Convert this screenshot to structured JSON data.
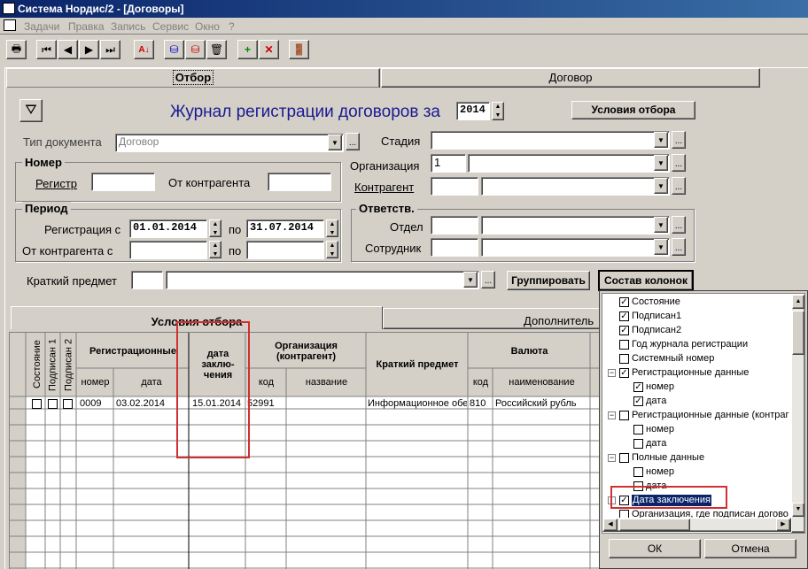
{
  "window": {
    "title": "Система Нордис/2 - [Договоры]"
  },
  "menu": [
    "Задачи",
    "Правка",
    "Запись",
    "Сервис",
    "Окно",
    "?"
  ],
  "tabs": {
    "top_left": "Отбор",
    "top_right": "Договор",
    "bottom_left": "Условия отбора",
    "bottom_right": "Дополнитель"
  },
  "header": {
    "title": "Журнал регистрации договоров за",
    "year": "2014",
    "conditions_button": "Условия отбора"
  },
  "form": {
    "doc_type_label": "Тип документа",
    "doc_type_value": "Договор",
    "stage_label": "Стадия",
    "number_group": "Номер",
    "register_label": "Регистр",
    "from_contractor_label": "От контрагента",
    "org_label": "Организация",
    "org_code": "1",
    "contractor_label": "Контрагент",
    "period_group": "Период",
    "reg_from_label": "Регистрация с",
    "reg_from": "01.01.2014",
    "to_label": "по",
    "reg_to": "31.07.2014",
    "contractor_from_label": "От контрагента с",
    "to_label2": "по",
    "resp_group": "Ответств.",
    "dept_label": "Отдел",
    "employee_label": "Сотрудник",
    "subject_label": "Краткий предмет",
    "group_button": "Группировать",
    "columns_button": "Состав колонок"
  },
  "grid": {
    "vheaders": [
      "Состояние",
      "Подписан 1",
      "Подписан 2"
    ],
    "h_reg": "Регистрационные",
    "h_date": "дата заклю- чения",
    "h_org": "Организация (контрагент)",
    "h_subject": "Краткий предмет",
    "h_currency": "Валюта",
    "s_number": "номер",
    "s_date": "дата",
    "s_code": "код",
    "s_name": "название",
    "s_code2": "код",
    "s_curname": "наименование",
    "rows": [
      {
        "number": "0009",
        "date": "03.02.2014",
        "contract_date": "15.01.2014",
        "org_code": "52991",
        "org_name": "",
        "subject": "Информационное обе",
        "cur_code": "810",
        "cur_name": "Российский рубль"
      }
    ]
  },
  "columns_popup": {
    "items": [
      {
        "label": "Состояние",
        "checked": "✓"
      },
      {
        "label": "Подписан1",
        "checked": "✓"
      },
      {
        "label": "Подписан2",
        "checked": "✓"
      },
      {
        "label": "Год журнала регистрации",
        "checked": ""
      },
      {
        "label": "Системный номер",
        "checked": ""
      },
      {
        "label": "Регистрационные данные",
        "checked": "✓"
      },
      {
        "label": "номер",
        "checked": "✓"
      },
      {
        "label": "дата",
        "checked": "✓"
      },
      {
        "label": "Регистрационные данные (контраг",
        "checked": ""
      },
      {
        "label": "номер",
        "checked": ""
      },
      {
        "label": "дата",
        "checked": ""
      },
      {
        "label": "Полные данные",
        "checked": ""
      },
      {
        "label": "номер",
        "checked": ""
      },
      {
        "label": "дата",
        "checked": ""
      },
      {
        "label": "Дата заключения",
        "checked": "✓"
      },
      {
        "label": "Организация, где подписан догово",
        "checked": ""
      }
    ],
    "ok": "ОК",
    "cancel": "Отмена"
  }
}
